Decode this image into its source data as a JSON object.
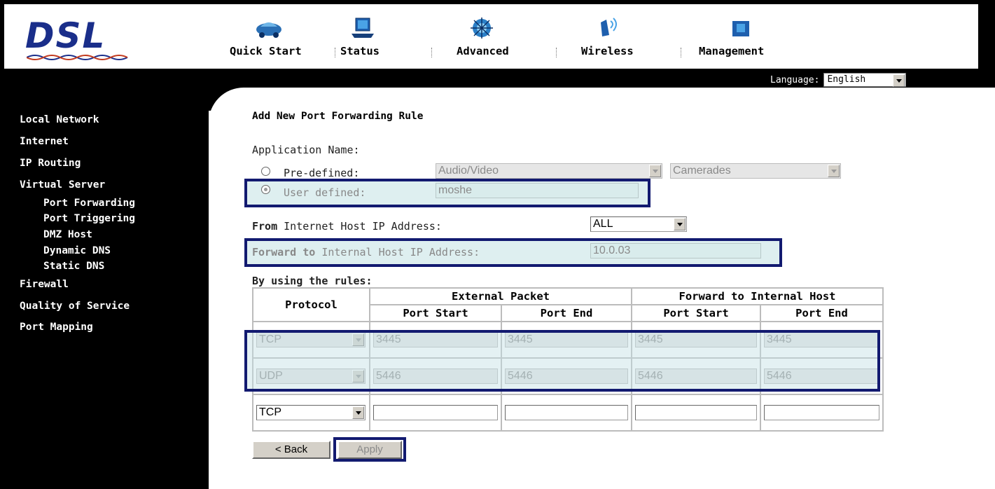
{
  "brand": {
    "logo_text": "DSL"
  },
  "nav": [
    {
      "label": "Quick Start",
      "icon": "car-icon"
    },
    {
      "label": "Status",
      "icon": "laptop-icon"
    },
    {
      "label": "Advanced",
      "icon": "chip-icon"
    },
    {
      "label": "Wireless",
      "icon": "wireless-icon"
    },
    {
      "label": "Management",
      "icon": "folder-icon"
    }
  ],
  "language": {
    "label": "Language:",
    "value": "English"
  },
  "sidebar": [
    {
      "label": "Local Network"
    },
    {
      "label": "Internet"
    },
    {
      "label": "IP Routing"
    },
    {
      "label": "Virtual Server"
    },
    {
      "label": "Port Forwarding"
    },
    {
      "label": "Port Triggering"
    },
    {
      "label": "DMZ Host"
    },
    {
      "label": "Dynamic DNS"
    },
    {
      "label": "Static DNS"
    },
    {
      "label": "Firewall"
    },
    {
      "label": "Quality of Service"
    },
    {
      "label": "Port Mapping"
    }
  ],
  "form": {
    "title": "Add New Port Forwarding Rule",
    "app_name_label": "Application Name:",
    "predefined_label": "Pre-defined:",
    "predefined_category": "Audio/Video",
    "predefined_app": "Camerades",
    "user_defined_label": "User defined:",
    "user_defined_value": "moshe",
    "from_bold": "From",
    "from_rest": " Internet Host IP Address:",
    "from_value": "ALL",
    "forward_bold": "Forward to",
    "forward_rest": " Internal Host IP Address:",
    "forward_value": "10.0.03"
  },
  "rules": {
    "heading": "By using the rules:",
    "col_protocol": "Protocol",
    "group_external": "External Packet",
    "group_internal": "Forward to Internal Host",
    "col_port_start": "Port Start",
    "col_port_end": "Port End",
    "rows": [
      {
        "protocol": "TCP",
        "ext_start": "3445",
        "ext_end": "3445",
        "int_start": "3445",
        "int_end": "3445"
      },
      {
        "protocol": "UDP",
        "ext_start": "5446",
        "ext_end": "5446",
        "int_start": "5446",
        "int_end": "5446"
      },
      {
        "protocol": "TCP",
        "ext_start": "",
        "ext_end": "",
        "int_start": "",
        "int_end": ""
      }
    ]
  },
  "buttons": {
    "back": "< Back",
    "apply": "Apply"
  }
}
